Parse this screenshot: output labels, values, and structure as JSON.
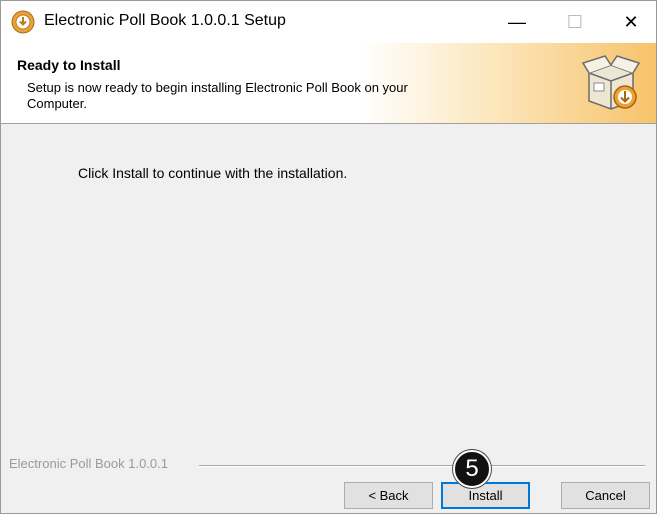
{
  "window": {
    "title": "Electronic Poll Book 1.0.0.1 Setup",
    "minimize_glyph": "—",
    "maximize_glyph": "☐",
    "close_glyph": "✕"
  },
  "header": {
    "title": "Ready to Install",
    "subtitle": "Setup is now ready to begin installing Electronic Poll Book on your Computer.",
    "icon": "install-box-icon"
  },
  "body": {
    "instruction": "Click Install to continue with the installation."
  },
  "footer": {
    "brand": "Electronic Poll Book 1.0.0.1",
    "back_label": "< Back",
    "install_label": "Install",
    "cancel_label": "Cancel"
  },
  "annotation": {
    "step_number": "5"
  },
  "colors": {
    "accent": "#0078d7",
    "header_gradient_end": "#f6c36a",
    "marker": "#111111"
  }
}
